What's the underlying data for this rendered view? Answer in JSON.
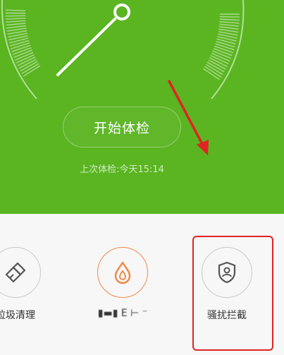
{
  "header": {
    "start_button_label": "开始体检",
    "last_check_text": "上次体检:今天15:14"
  },
  "tools": [
    {
      "label": "垃圾清理",
      "icon": "broom-icon",
      "accent": "#555555"
    },
    {
      "label": "▮▬▮ E ⊢ ⁻",
      "icon": "water-drop-icon",
      "accent": "#f08a4b"
    },
    {
      "label": "骚扰拦截",
      "icon": "shield-user-icon",
      "accent": "#555555"
    }
  ],
  "colors": {
    "green": "#5ab521",
    "annotation_red": "#e02424",
    "orange": "#f08a4b"
  }
}
